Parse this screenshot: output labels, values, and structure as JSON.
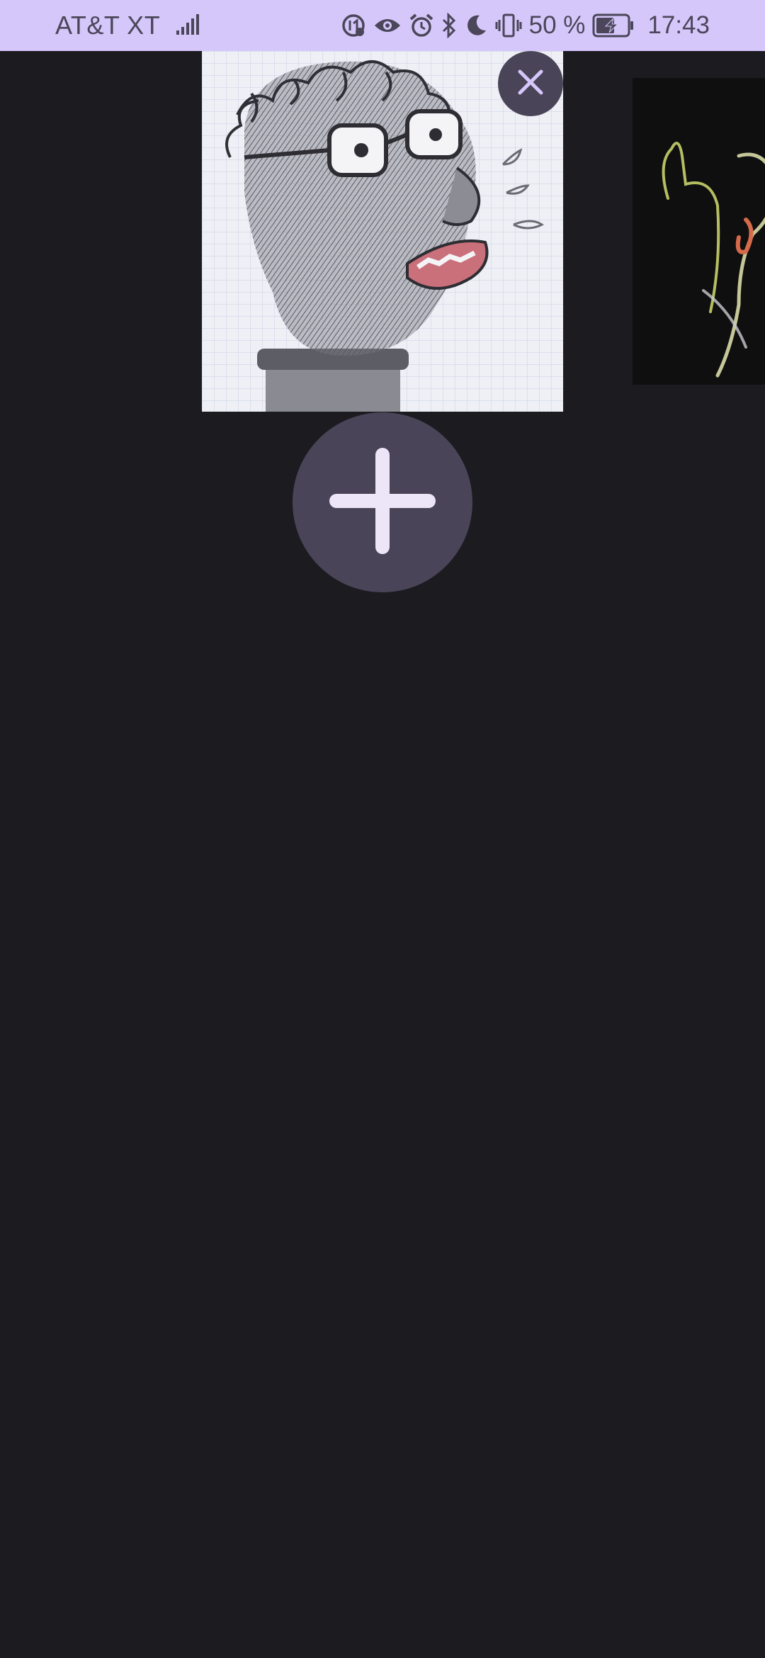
{
  "status_bar": {
    "carrier": "AT&T XT",
    "battery_percent": "50 %",
    "time": "17:43",
    "icons": [
      "signal-icon",
      "data-saver-icon",
      "eye-icon",
      "alarm-icon",
      "bluetooth-icon",
      "do-not-disturb-icon",
      "vibrate-icon",
      "battery-charging-icon"
    ]
  },
  "gallery": {
    "photos": [
      {
        "name": "sketch-portrait-photo",
        "selected": true
      },
      {
        "name": "neon-figure-photo",
        "selected": false
      }
    ],
    "remove_icon": "close-icon",
    "add_icon": "plus-icon"
  },
  "colors": {
    "background": "#1c1b20",
    "status_bar": "#d6c7fb",
    "button_fill": "#4a4458",
    "close_icon": "#d6c7fb",
    "plus_icon": "#ece6f8"
  }
}
